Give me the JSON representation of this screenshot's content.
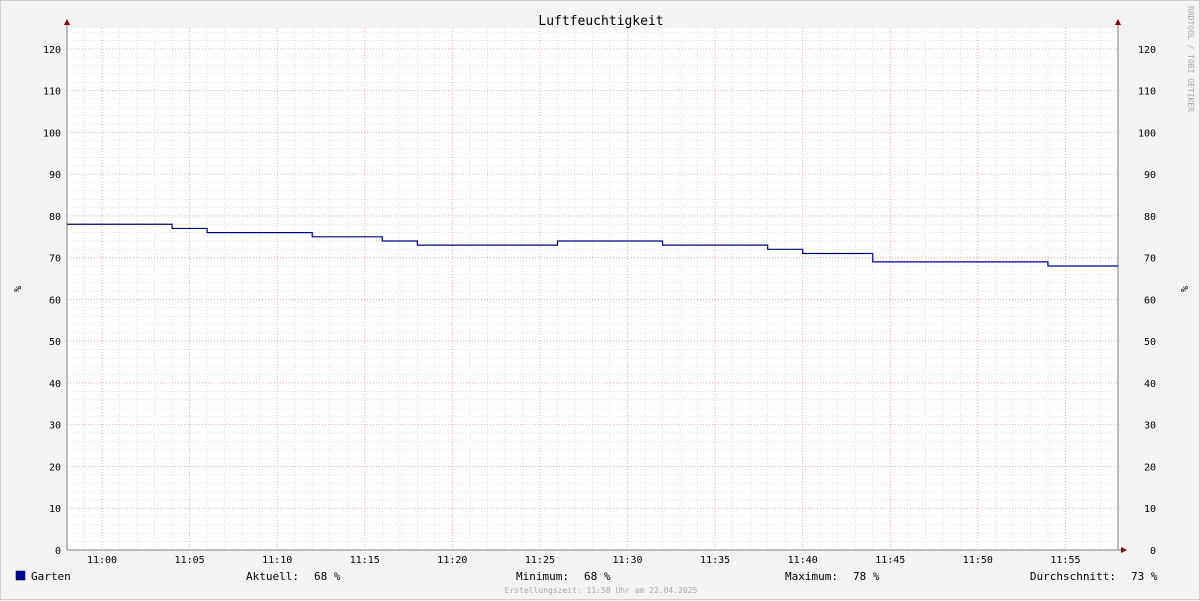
{
  "chart_data": {
    "type": "line",
    "title": "Luftfeuchtigkeit",
    "ylabel": "%",
    "ylabel_right": "%",
    "ylim": [
      0,
      125
    ],
    "y_ticks": [
      0,
      10,
      20,
      30,
      40,
      50,
      60,
      70,
      80,
      90,
      100,
      110,
      120
    ],
    "x_range": [
      "10:58",
      "11:58"
    ],
    "x_ticks": [
      "11:00",
      "11:05",
      "11:10",
      "11:15",
      "11:20",
      "11:25",
      "11:30",
      "11:35",
      "11:40",
      "11:45",
      "11:50",
      "11:55"
    ],
    "grid": true,
    "series": [
      {
        "name": "Garten",
        "color": "#000080",
        "step": true,
        "x": [
          "10:58",
          "11:04",
          "11:06",
          "11:12",
          "11:16",
          "11:18",
          "11:26",
          "11:32",
          "11:38",
          "11:40",
          "11:44",
          "11:54"
        ],
        "values": [
          78,
          77,
          76,
          75,
          74,
          73,
          74,
          73,
          72,
          71,
          69,
          68
        ]
      }
    ],
    "side_text": "RRDTOOL / TOBI OETIKER"
  },
  "legend": {
    "series_name": "Garten",
    "swatch_color": "#0000a0",
    "stats": [
      {
        "label": "Aktuell:",
        "value": "68 %"
      },
      {
        "label": "Minimum:",
        "value": "68 %"
      },
      {
        "label": "Maximum:",
        "value": "78 %"
      },
      {
        "label": "Durchschnitt:",
        "value": "73 %"
      }
    ]
  },
  "footer": "Erstellungszeit: 11:58 Uhr am 22.04.2025",
  "colors": {
    "background": "#f3f3f3",
    "plot_bg": "#ffffff",
    "major_grid": "#e0a0a0",
    "minor_grid": "#d0d0d0",
    "axis": "#808080",
    "arrow": "#8b0000"
  }
}
